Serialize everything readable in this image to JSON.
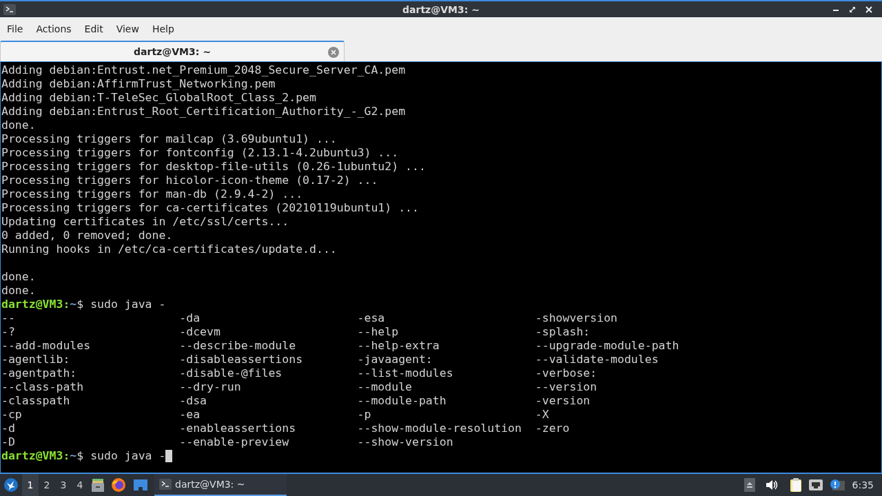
{
  "window": {
    "title": "dartz@VM3: ~"
  },
  "menu": [
    "File",
    "Actions",
    "Edit",
    "View",
    "Help"
  ],
  "tabs": [
    {
      "label": "dartz@VM3: ~",
      "selected": true
    }
  ],
  "terminal": {
    "lines": [
      {
        "kind": "output",
        "text": "Adding debian:Entrust.net_Premium_2048_Secure_Server_CA.pem"
      },
      {
        "kind": "output",
        "text": "Adding debian:AffirmTrust_Networking.pem"
      },
      {
        "kind": "output",
        "text": "Adding debian:T-TeleSec_GlobalRoot_Class_2.pem"
      },
      {
        "kind": "output",
        "text": "Adding debian:Entrust_Root_Certification_Authority_-_G2.pem"
      },
      {
        "kind": "output",
        "text": "done."
      },
      {
        "kind": "output",
        "text": "Processing triggers for mailcap (3.69ubuntu1) ..."
      },
      {
        "kind": "output",
        "text": "Processing triggers for fontconfig (2.13.1-4.2ubuntu3) ..."
      },
      {
        "kind": "output",
        "text": "Processing triggers for desktop-file-utils (0.26-1ubuntu2) ..."
      },
      {
        "kind": "output",
        "text": "Processing triggers for hicolor-icon-theme (0.17-2) ..."
      },
      {
        "kind": "output",
        "text": "Processing triggers for man-db (2.9.4-2) ..."
      },
      {
        "kind": "output",
        "text": "Processing triggers for ca-certificates (20210119ubuntu1) ..."
      },
      {
        "kind": "output",
        "text": "Updating certificates in /etc/ssl/certs..."
      },
      {
        "kind": "output",
        "text": "0 added, 0 removed; done."
      },
      {
        "kind": "output",
        "text": "Running hooks in /etc/ca-certificates/update.d..."
      },
      {
        "kind": "blank"
      },
      {
        "kind": "output",
        "text": "done."
      },
      {
        "kind": "output",
        "text": "done."
      },
      {
        "kind": "prompt",
        "user": "dartz@VM3",
        "sep": ":",
        "path": "~",
        "end": "$",
        "command": "sudo java -",
        "cursor": false
      },
      {
        "kind": "columns",
        "cells": [
          "--",
          "-da",
          "-esa",
          "-showversion"
        ]
      },
      {
        "kind": "columns",
        "cells": [
          "-?",
          "-dcevm",
          "--help",
          "-splash:"
        ]
      },
      {
        "kind": "columns",
        "cells": [
          "--add-modules",
          "--describe-module",
          "--help-extra",
          "--upgrade-module-path"
        ]
      },
      {
        "kind": "columns",
        "cells": [
          "-agentlib:",
          "-disableassertions",
          "-javaagent:",
          "--validate-modules"
        ]
      },
      {
        "kind": "columns",
        "cells": [
          "-agentpath:",
          "-disable-@files",
          "--list-modules",
          "-verbose:"
        ]
      },
      {
        "kind": "columns",
        "cells": [
          "--class-path",
          "--dry-run",
          "--module",
          "--version"
        ]
      },
      {
        "kind": "columns",
        "cells": [
          "-classpath",
          "-dsa",
          "--module-path",
          "-version"
        ]
      },
      {
        "kind": "columns",
        "cells": [
          "-cp",
          "-ea",
          "-p",
          "-X"
        ]
      },
      {
        "kind": "columns",
        "cells": [
          "-d",
          "-enableassertions",
          "--show-module-resolution",
          "-zero"
        ]
      },
      {
        "kind": "columns",
        "cells": [
          "-D",
          "--enable-preview",
          "--show-version"
        ]
      },
      {
        "kind": "prompt",
        "user": "dartz@VM3",
        "sep": ":",
        "path": "~",
        "end": "$",
        "command": "sudo java -",
        "cursor": true
      }
    ]
  },
  "taskbar": {
    "workspaces": [
      {
        "label": "1",
        "selected": true
      },
      {
        "label": "2",
        "selected": false
      },
      {
        "label": "3",
        "selected": false
      },
      {
        "label": "4",
        "selected": false
      }
    ],
    "tasks": [
      {
        "label": "dartz@VM3: ~",
        "selected": true
      }
    ],
    "clock": "6:35"
  }
}
